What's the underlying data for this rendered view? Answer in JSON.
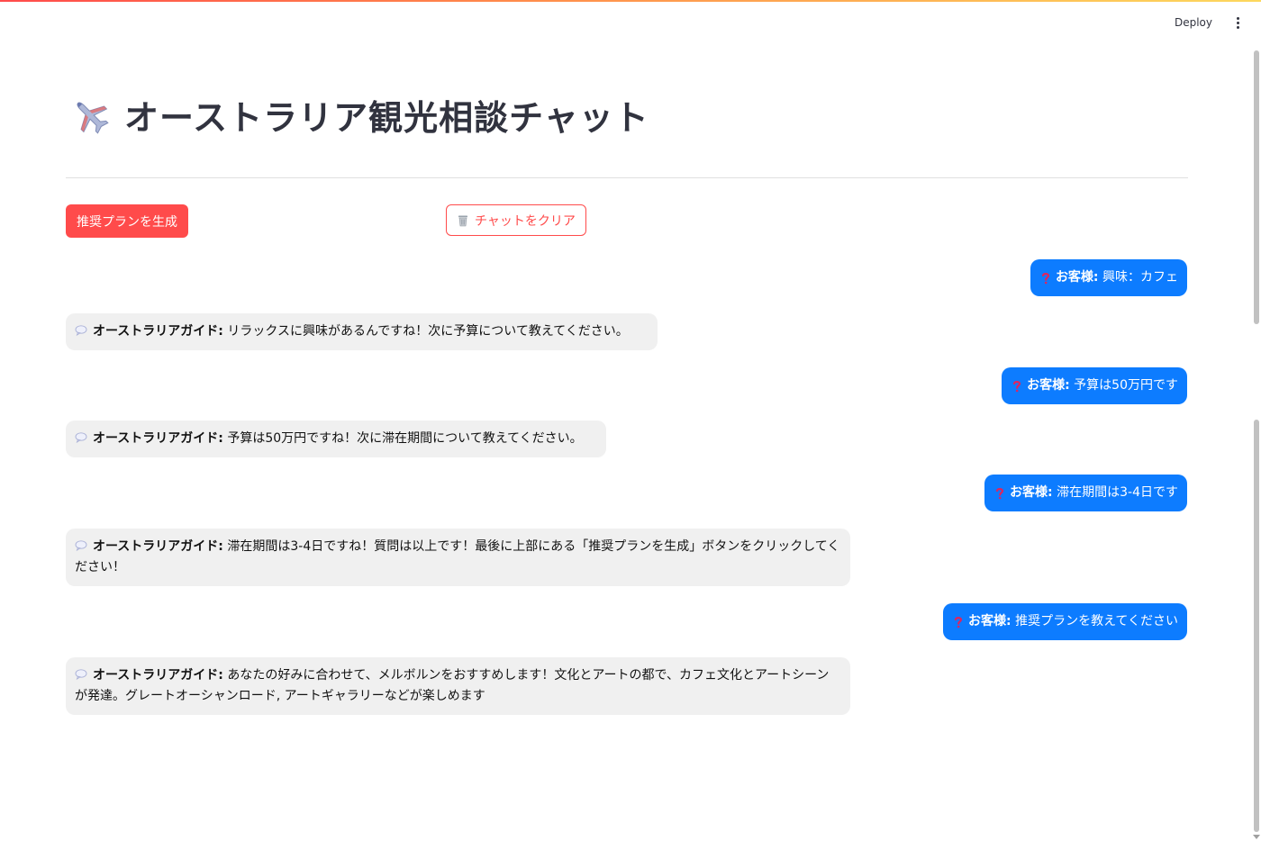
{
  "header": {
    "deploy_label": "Deploy"
  },
  "page": {
    "title": "オーストラリア観光相談チャット"
  },
  "actions": {
    "generate_label": "推奨プランを生成",
    "clear_label": "チャットをクリア"
  },
  "chat": {
    "user_label": "お客様:",
    "guide_label": "オーストラリアガイド:",
    "messages": [
      {
        "role": "user",
        "text": "興味：カフェ"
      },
      {
        "role": "guide",
        "text": "リラックスに興味があるんですね！次に予算について教えてください。"
      },
      {
        "role": "user",
        "text": "予算は50万円です"
      },
      {
        "role": "guide",
        "text": "予算は50万円ですね！次に滞在期間について教えてください。"
      },
      {
        "role": "user",
        "text": "滞在期間は3-4日です"
      },
      {
        "role": "guide",
        "text": "滞在期間は3-4日ですね！質問は以上です！最後に上部にある「推奨プランを生成」ボタンをクリックしてください！"
      },
      {
        "role": "user",
        "text": "推奨プランを教えてください"
      },
      {
        "role": "guide",
        "text": "あなたの好みに合わせて、メルボルンをおすすめします！文化とアートの都で、カフェ文化とアートシーンが発達。グレートオーシャンロード, アートギャラリーなどが楽しめます"
      }
    ]
  },
  "colors": {
    "primary": "#ff4b4b",
    "user_bubble": "#0d7cff",
    "guide_bubble": "#f0f0f0"
  }
}
